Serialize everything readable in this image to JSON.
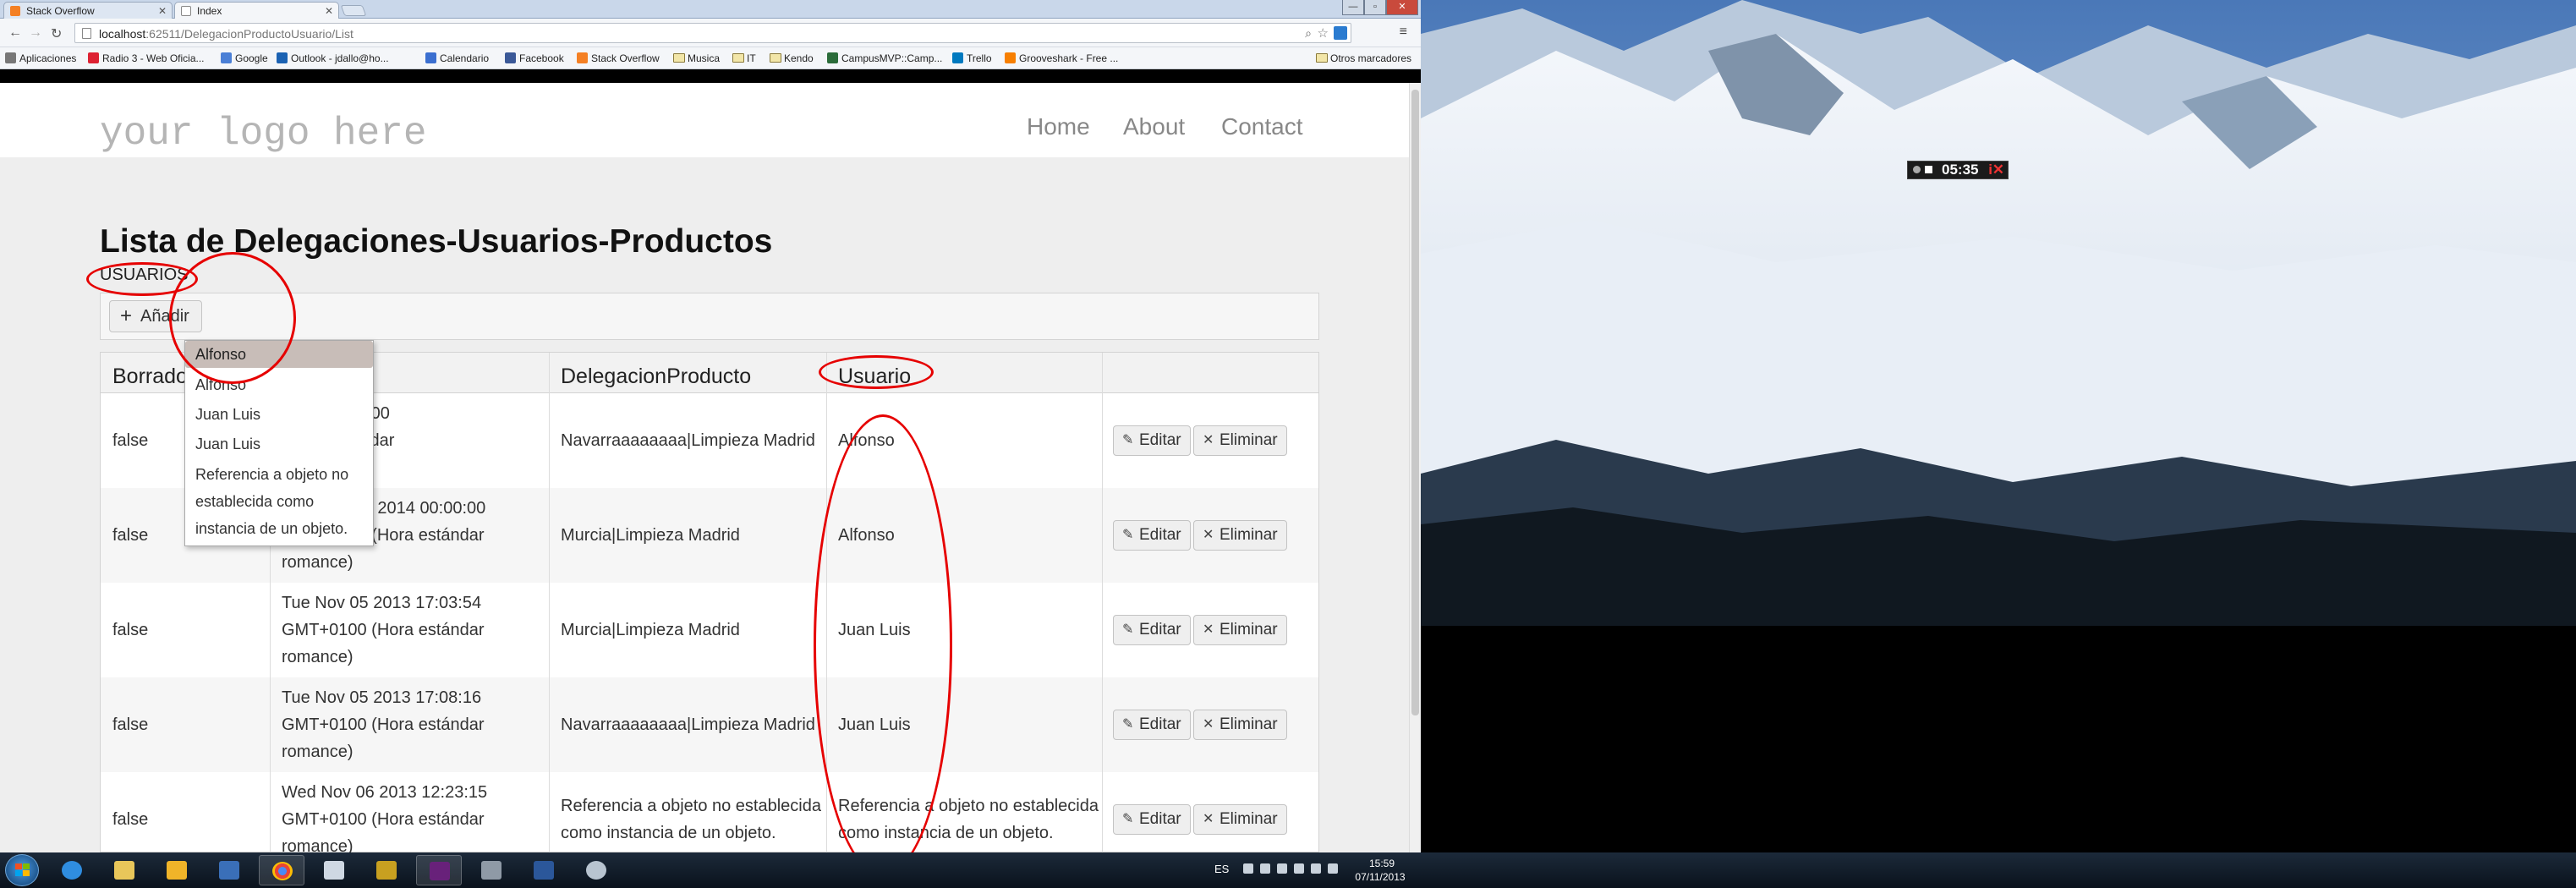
{
  "browser": {
    "tabs": [
      {
        "label": "Stack Overflow"
      },
      {
        "label": "Index"
      }
    ],
    "url_host": "localhost",
    "url_rest": ":62511/DelegacionProductoUsuario/List",
    "bookmarks": [
      "Aplicaciones",
      "Radio 3 - Web Oficia...",
      "Google",
      "Outlook - jdallo@ho...",
      "Calendario",
      "Facebook",
      "Stack Overflow",
      "Musica",
      "IT",
      "Kendo",
      "CampusMVP::Camp...",
      "Trello",
      "Grooveshark - Free ...",
      "Otros marcadores"
    ]
  },
  "site": {
    "logo": "your logo here",
    "nav": [
      "Home",
      "About",
      "Contact"
    ]
  },
  "page": {
    "title": "Lista de Delegaciones-Usuarios-Productos",
    "usuarios_label": "USUARIOS",
    "add_label": "Añadir"
  },
  "dropdown": {
    "selected": "Alfonso",
    "options": [
      "Alfonso",
      "Juan Luis",
      "Juan Luis"
    ],
    "error_lines": [
      "Referencia a objeto no",
      "establecida como",
      "instancia de un objeto."
    ]
  },
  "grid": {
    "columns": [
      "Borrado",
      "",
      "DelegacionProducto",
      "Usuario",
      ""
    ],
    "edit_label": "Editar",
    "delete_label": "Eliminar",
    "rows": [
      {
        "borrado": "false",
        "fecha": [
          "2014 00:00:00",
          "(Hora estándar",
          "romance)"
        ],
        "delegacion": [
          "Navarraaaaaaaa|Limpieza Madrid"
        ],
        "usuario": [
          "Alfonso"
        ]
      },
      {
        "borrado": "false",
        "fecha": [
          "Mon Dec 01 2014 00:00:00",
          "GMT+0100 (Hora estándar",
          "romance)"
        ],
        "delegacion": [
          "Murcia|Limpieza Madrid"
        ],
        "usuario": [
          "Alfonso"
        ]
      },
      {
        "borrado": "false",
        "fecha": [
          "Tue Nov 05 2013 17:03:54",
          "GMT+0100 (Hora estándar",
          "romance)"
        ],
        "delegacion": [
          "Murcia|Limpieza Madrid"
        ],
        "usuario": [
          "Juan Luis"
        ]
      },
      {
        "borrado": "false",
        "fecha": [
          "Tue Nov 05 2013 17:08:16",
          "GMT+0100 (Hora estándar",
          "romance)"
        ],
        "delegacion": [
          "Navarraaaaaaaa|Limpieza Madrid"
        ],
        "usuario": [
          "Juan Luis"
        ]
      },
      {
        "borrado": "false",
        "fecha": [
          "Wed Nov 06 2013 12:23:15",
          "GMT+0100 (Hora estándar",
          "romance)"
        ],
        "delegacion": [
          "Referencia a objeto no establecida",
          "como instancia de un objeto."
        ],
        "usuario": [
          "Referencia a objeto no establecida",
          "como instancia de un objeto."
        ]
      }
    ]
  },
  "desktop": {
    "recorder_time": "05:35"
  },
  "taskbar": {
    "lang": "ES",
    "time": "15:59",
    "date": "07/11/2013"
  },
  "colors": {
    "annotation": "#e60000",
    "link": "#888888",
    "selected_option": "#c8bdb8"
  }
}
